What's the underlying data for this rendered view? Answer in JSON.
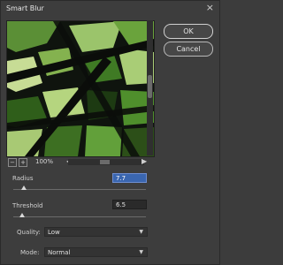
{
  "dialog": {
    "title": "Smart Blur",
    "ok_label": "OK",
    "cancel_label": "Cancel"
  },
  "preview": {
    "zoom_out_symbol": "−",
    "zoom_in_symbol": "+",
    "zoom_label": "100%",
    "left_arrow": "◀",
    "right_arrow": "▶"
  },
  "controls": {
    "radius_label": "Radius",
    "radius_value": "7.7",
    "radius_level": 0.077,
    "threshold_label": "Threshold",
    "threshold_value": "6.5",
    "threshold_level": 0.065,
    "quality_label": "Quality:",
    "quality_value": "Low",
    "mode_label": "Mode:",
    "mode_value": "Normal"
  },
  "colors": {
    "accent_field": "#3a66b0",
    "preview_dark": "#0d100c",
    "leaf_green": "#4e8f2a"
  }
}
